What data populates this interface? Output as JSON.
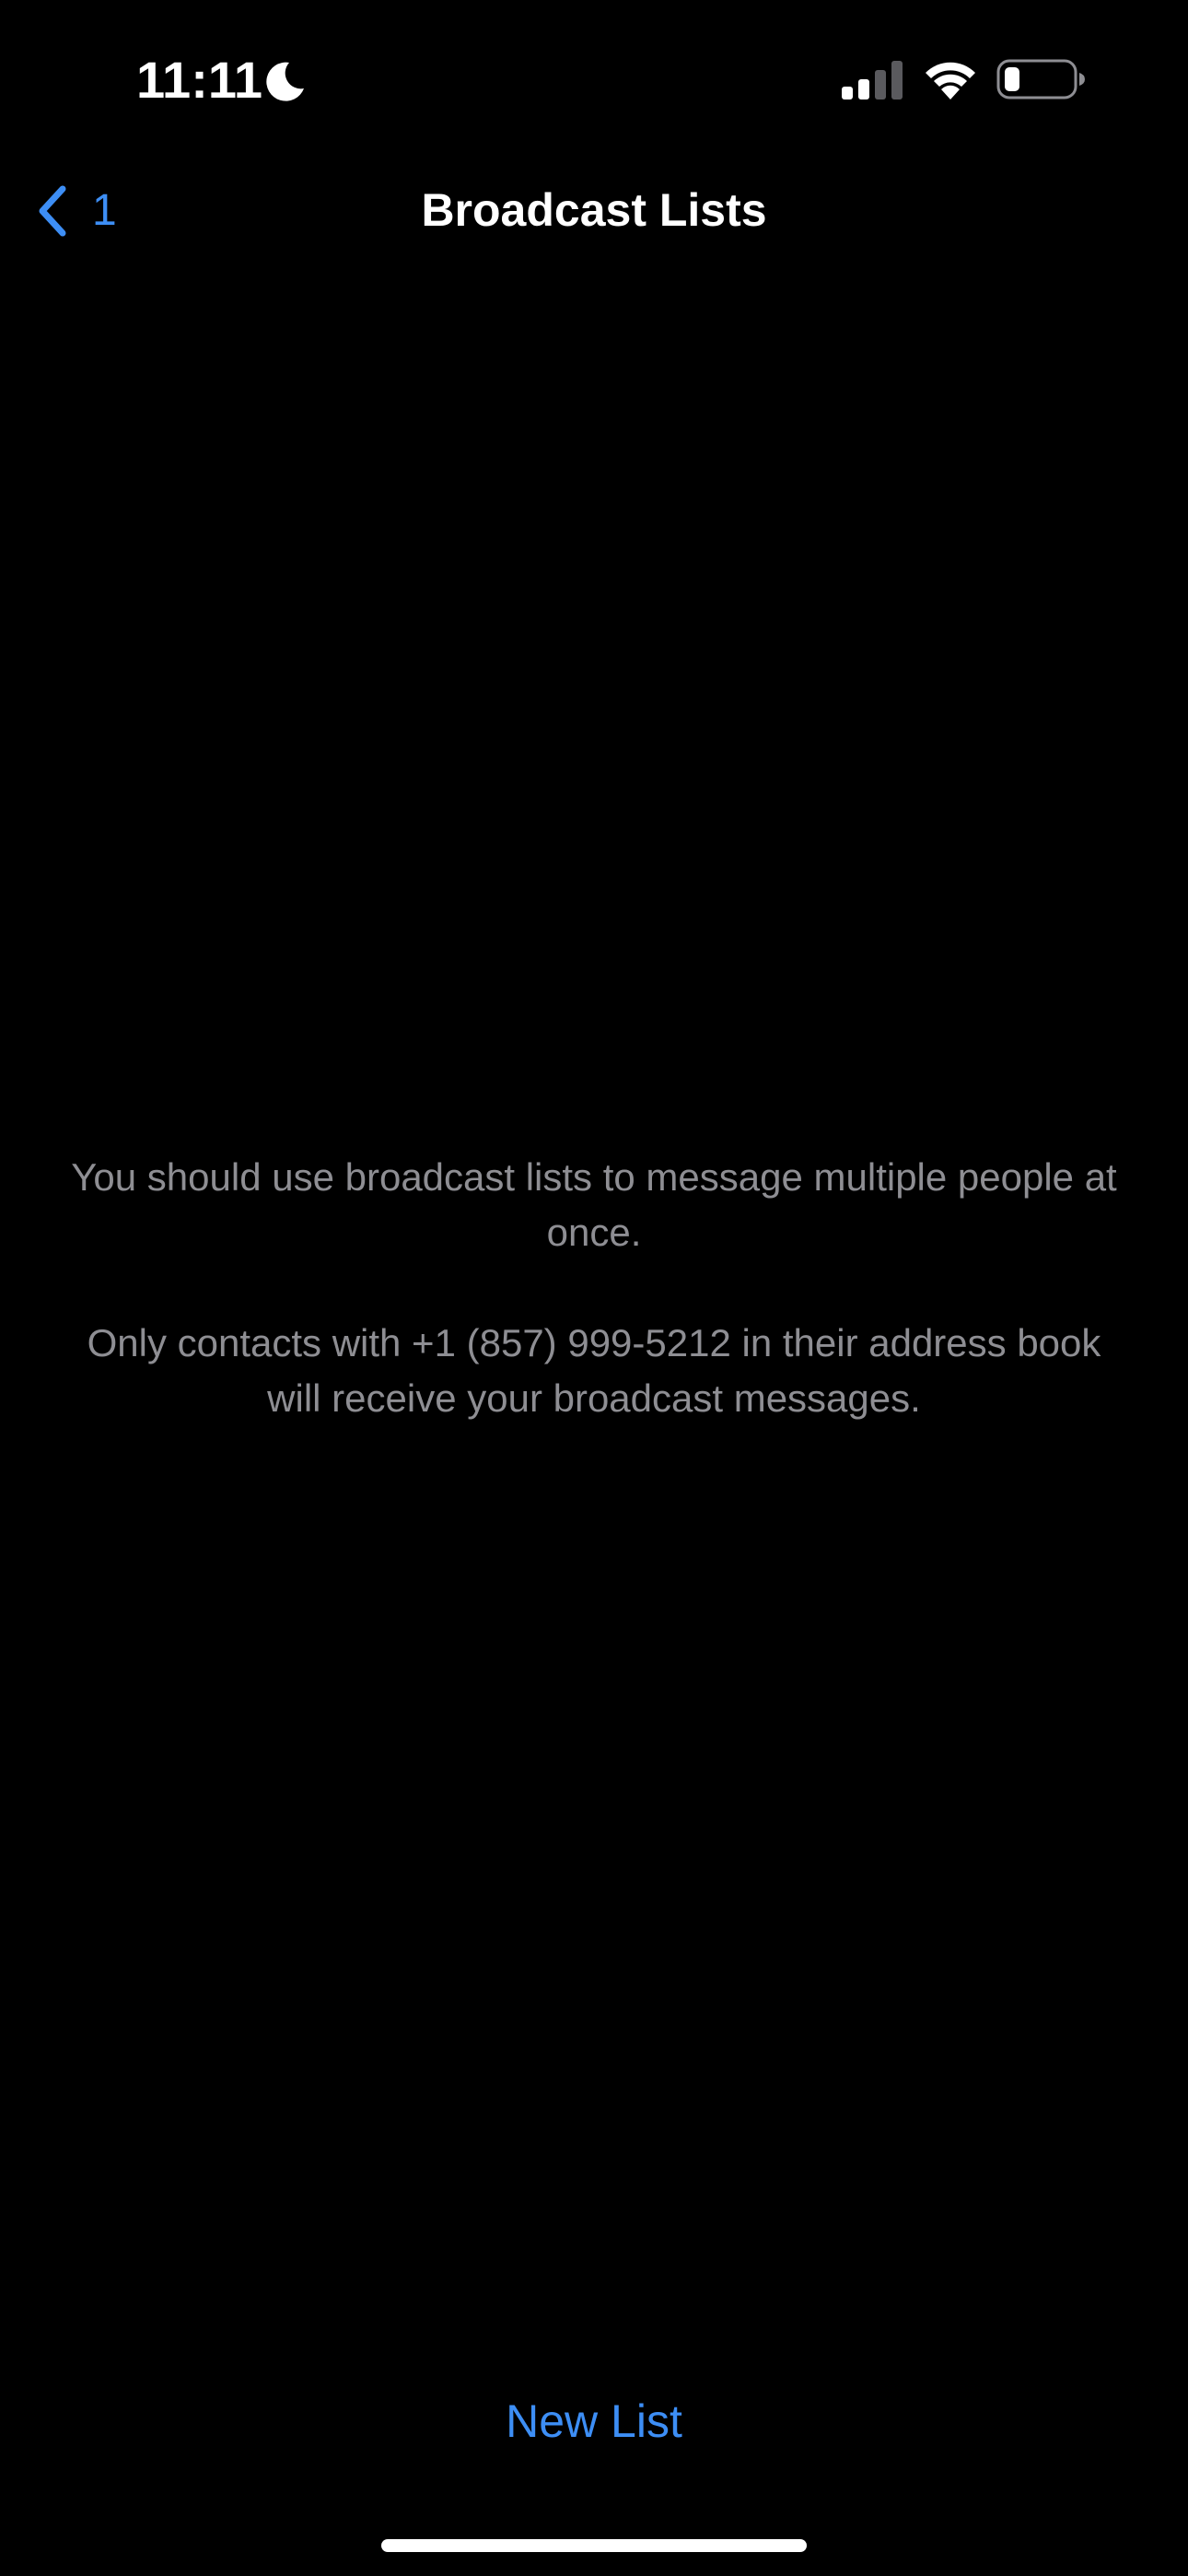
{
  "status_bar": {
    "time": "11:11",
    "moon_icon": "moon-icon",
    "signal_icon": "cellular-signal-icon",
    "wifi_icon": "wifi-icon",
    "battery_icon": "battery-icon"
  },
  "nav": {
    "back_count": "1",
    "back_icon": "chevron-left-icon",
    "title": "Broadcast Lists"
  },
  "message": {
    "line1": "You should use broadcast lists to message multiple people at once.",
    "line2": "Only contacts with +1 (857) 999-5212 in their address book will receive your broadcast messages."
  },
  "actions": {
    "new_list": "New List"
  },
  "colors": {
    "background": "#000000",
    "accent": "#3d8ef5",
    "secondary_text": "#8e8e93",
    "primary_text": "#ffffff"
  }
}
